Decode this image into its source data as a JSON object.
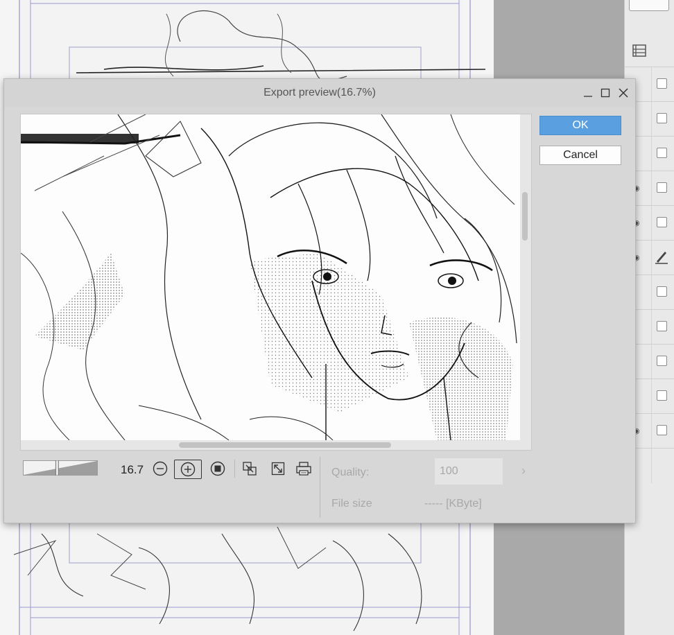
{
  "dialog": {
    "title": "Export preview(16.7%)",
    "ok_label": "OK",
    "cancel_label": "Cancel",
    "zoom_value": "16.7",
    "zoom_percent": 16.7,
    "quality_label": "Quality:",
    "quality_value": "100",
    "filesize_label": "File size",
    "filesize_value": "----- [KByte]"
  },
  "icons": {
    "minimize": "minimize-icon",
    "maximize": "maximize-icon",
    "close": "close-icon",
    "zoom_out": "zoom-out-icon",
    "zoom_in": "zoom-in-icon",
    "actual_size": "actual-size-icon",
    "fit_window": "fit-window-icon",
    "expand": "expand-icon",
    "preview_print": "print-preview-icon"
  },
  "colors": {
    "ok_button": "#5aa0e0",
    "title_bar": "#d4d4d4",
    "dialog_body": "#d7d7d7",
    "disabled_text": "#a8a8a8"
  }
}
